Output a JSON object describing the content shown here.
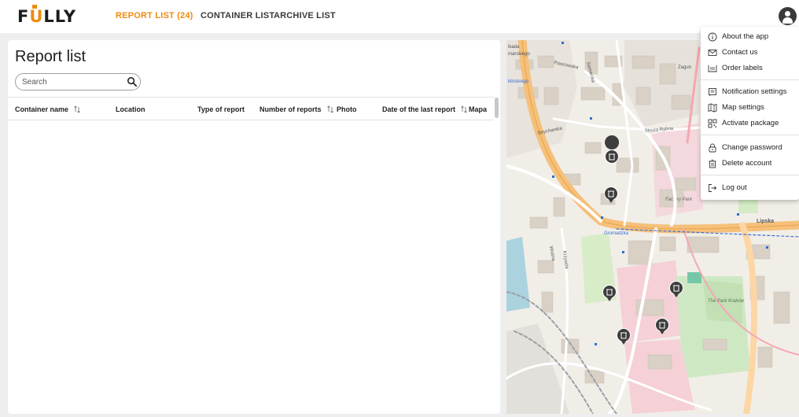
{
  "brand": {
    "name": "FULLY",
    "accent": "#f08a10"
  },
  "nav": {
    "tabs": [
      {
        "label": "REPORT LIST (24)",
        "active": true
      },
      {
        "label": "CONTAINER LIST",
        "active": false
      },
      {
        "label": "ARCHIVE LIST",
        "active": false
      }
    ]
  },
  "report": {
    "title": "Report list",
    "search_placeholder": "Search",
    "columns": [
      {
        "label": "Container name",
        "sortable": true
      },
      {
        "label": "Location",
        "sortable": false
      },
      {
        "label": "Type of report",
        "sortable": false
      },
      {
        "label": "Number of reports",
        "sortable": true
      },
      {
        "label": "Photo",
        "sortable": false
      },
      {
        "label": "Date of the last report",
        "sortable": true
      },
      {
        "label": "Mapa",
        "sortable": false
      }
    ],
    "rows": []
  },
  "map": {
    "labels": {
      "street_1": "Piaszowska",
      "street_2": "Samarcka",
      "street_3": "Strycharska",
      "street_4": "Struza Rybna",
      "street_5": "Lipska",
      "street_6": "Gromadzka",
      "street_7": "Wodna",
      "street_8": "Krzywda",
      "place_1": "Factory Park",
      "place_2": "The Park Kraków",
      "place_3": "Zagun",
      "place_4": "ikada",
      "place_5": "marskiego",
      "place_6": "klinskiego"
    }
  },
  "user_menu": {
    "items": [
      {
        "label": "About the app",
        "icon": "info-icon"
      },
      {
        "label": "Contact us",
        "icon": "mail-icon"
      },
      {
        "label": "Order labels",
        "icon": "label-icon"
      },
      {
        "label": "Notification settings",
        "icon": "notification-icon"
      },
      {
        "label": "Map settings",
        "icon": "map-icon"
      },
      {
        "label": "Activate package",
        "icon": "qr-icon"
      },
      {
        "label": "Change password",
        "icon": "lock-icon"
      },
      {
        "label": "Delete account",
        "icon": "trash-icon"
      },
      {
        "label": "Log out",
        "icon": "logout-icon"
      }
    ]
  }
}
